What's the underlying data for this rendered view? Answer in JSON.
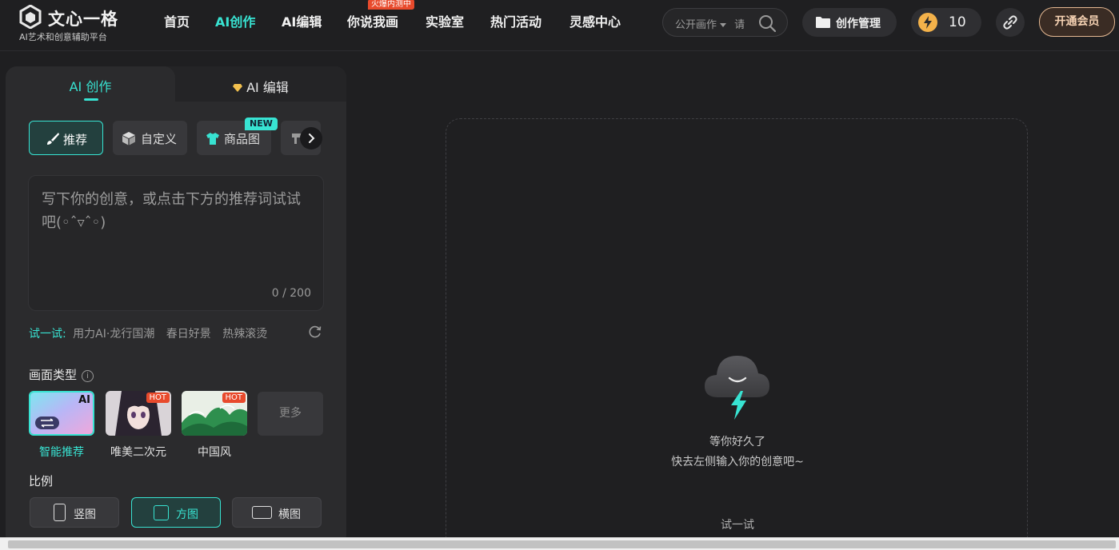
{
  "header": {
    "brand_name": "文心一格",
    "brand_slogan": "AI艺术和创意辅助平台",
    "nav": [
      {
        "label": "首页",
        "active": false
      },
      {
        "label": "AI创作",
        "active": true
      },
      {
        "label": "AI编辑",
        "active": false
      },
      {
        "label": "你说我画",
        "active": false,
        "badge": "火爆内测中"
      },
      {
        "label": "实验室",
        "active": false
      },
      {
        "label": "热门活动",
        "active": false
      },
      {
        "label": "灵感中心",
        "active": false
      }
    ],
    "search": {
      "scope": "公开画作",
      "placeholder_fragment": "请"
    },
    "manage_label": "创作管理",
    "energy_count": "10",
    "vip_label": "开通会员"
  },
  "panel": {
    "tabs": {
      "create": "AI 创作",
      "edit": "AI 编辑"
    },
    "modes": [
      {
        "label": "推荐",
        "icon": "brush-icon",
        "active": true
      },
      {
        "label": "自定义",
        "icon": "cube-icon",
        "active": false
      },
      {
        "label": "商品图",
        "icon": "tshirt-icon",
        "active": false,
        "tag": "NEW"
      }
    ],
    "prompt": {
      "placeholder": "写下你的创意，或点击下方的推荐词试试吧(◦ˆ▿ˆ◦)",
      "counter": "0 / 200"
    },
    "try": {
      "label": "试一试:",
      "items": [
        "用力AI·龙行国潮",
        "春日好景",
        "热辣滚烫"
      ]
    },
    "style_section": {
      "title": "画面类型",
      "info_glyph": "i",
      "styles": [
        {
          "name": "智能推荐",
          "tag": "AI",
          "active": true
        },
        {
          "name": "唯美二次元",
          "tag": "HOT",
          "active": false
        },
        {
          "name": "中国风",
          "tag": "HOT",
          "active": false
        }
      ],
      "more_label": "更多"
    },
    "ratio_section": {
      "title": "比例",
      "options": [
        {
          "label": "竖图",
          "active": false
        },
        {
          "label": "方图",
          "active": true
        },
        {
          "label": "横图",
          "active": false
        }
      ]
    }
  },
  "canvas": {
    "empty_line1": "等你好久了",
    "empty_line2": "快去左侧输入你的创意吧~",
    "try_label": "试一试"
  },
  "colors": {
    "accent": "#38e3d2",
    "hot": "#e84a2c",
    "background": "#1f1f21",
    "panel": "#2b2b2d"
  }
}
